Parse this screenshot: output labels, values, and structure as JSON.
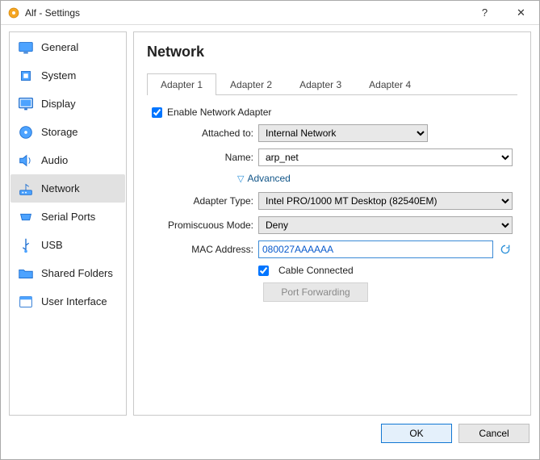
{
  "window": {
    "title": "Alf - Settings",
    "help": "?",
    "close": "✕"
  },
  "categories": [
    {
      "id": "general",
      "label": "General"
    },
    {
      "id": "system",
      "label": "System"
    },
    {
      "id": "display",
      "label": "Display"
    },
    {
      "id": "storage",
      "label": "Storage"
    },
    {
      "id": "audio",
      "label": "Audio"
    },
    {
      "id": "network",
      "label": "Network"
    },
    {
      "id": "serial-ports",
      "label": "Serial Ports"
    },
    {
      "id": "usb",
      "label": "USB"
    },
    {
      "id": "shared-folders",
      "label": "Shared Folders"
    },
    {
      "id": "user-interface",
      "label": "User Interface"
    }
  ],
  "page": {
    "title": "Network",
    "tabs": [
      "Adapter 1",
      "Adapter 2",
      "Adapter 3",
      "Adapter 4"
    ],
    "enable_adapter_label": "Enable Network Adapter",
    "attached_to_label": "Attached to:",
    "attached_to_value": "Internal Network",
    "name_label": "Name:",
    "name_value": "arp_net",
    "advanced_label": "Advanced",
    "adapter_type_label": "Adapter Type:",
    "adapter_type_value": "Intel PRO/1000 MT Desktop (82540EM)",
    "promiscuous_label": "Promiscuous Mode:",
    "promiscuous_value": "Deny",
    "mac_label": "MAC Address:",
    "mac_value": "080027AAAAAA",
    "cable_connected_label": "Cable Connected",
    "port_forwarding_label": "Port Forwarding"
  },
  "buttons": {
    "ok": "OK",
    "cancel": "Cancel"
  }
}
